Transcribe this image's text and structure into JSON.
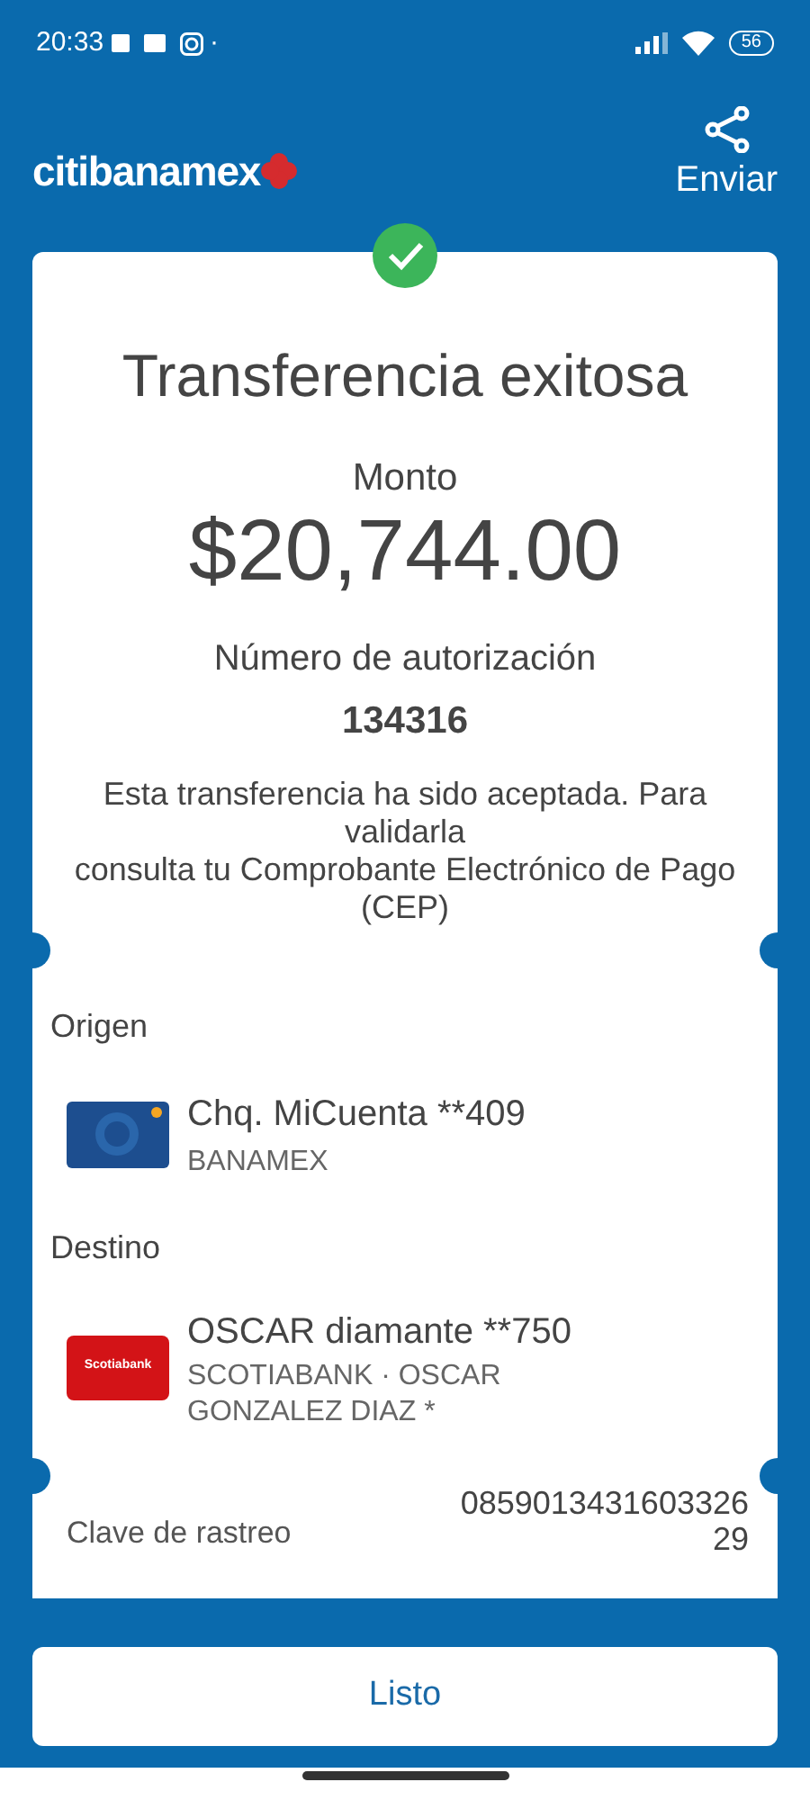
{
  "status_bar": {
    "time": "20:33",
    "dot": "·",
    "battery": "56"
  },
  "header": {
    "logo": "citibanamex",
    "share_label": "Enviar"
  },
  "receipt": {
    "title": "Transferencia exitosa",
    "amount_label": "Monto",
    "amount": "$20,744.00",
    "auth_label": "Número de autorización",
    "auth_number": "134316",
    "note": "Esta transferencia ha sido aceptada. Para validarla\nconsulta tu Comprobante Electrónico de Pago (CEP)",
    "origin": {
      "label": "Origen",
      "account": "Chq. MiCuenta **409",
      "bank": "BANAMEX",
      "kind": "debit-card"
    },
    "destination": {
      "label": "Destino",
      "account": "OSCAR diamante **750",
      "bank": "SCOTIABANK · OSCAR GONZALEZ DIAZ *",
      "kind": "bank-logo",
      "logo_text": "Scotiabank"
    },
    "tracking": {
      "label": "Clave de rastreo",
      "value": "0859013431603326\n29"
    }
  },
  "done_button": "Listo"
}
